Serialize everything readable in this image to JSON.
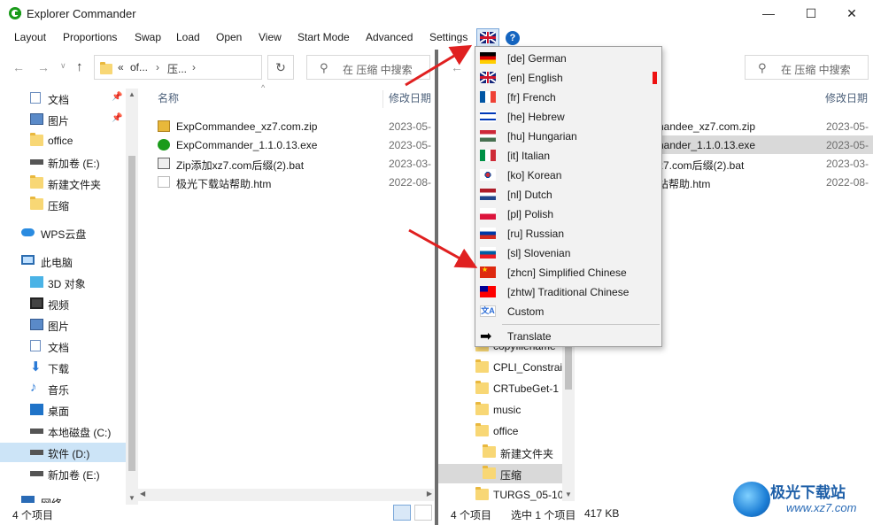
{
  "window": {
    "title": "Explorer Commander",
    "minimize": "—",
    "maximize": "☐",
    "close": "✕"
  },
  "menu": {
    "items": [
      "Layout",
      "Proportions",
      "Swap",
      "Load",
      "Open",
      "View",
      "Start Mode",
      "Advanced",
      "Settings"
    ],
    "help": "?"
  },
  "left_pane": {
    "path": [
      "«",
      "of...",
      "›",
      "压...",
      "›"
    ],
    "search_placeholder": "在 压缩 中搜索",
    "tree": [
      {
        "label": "文档",
        "icon": "document-icon",
        "pinned": true
      },
      {
        "label": "图片",
        "icon": "pictures-icon",
        "pinned": true
      },
      {
        "label": "office",
        "icon": "folder-icon"
      },
      {
        "label": "新加卷 (E:)",
        "icon": "drive-icon"
      },
      {
        "label": "新建文件夹",
        "icon": "folder-icon"
      },
      {
        "label": "压缩",
        "icon": "folder-icon"
      },
      {
        "label": "WPS云盘",
        "icon": "cloud-icon"
      },
      {
        "label": "此电脑",
        "icon": "computer-icon"
      },
      {
        "label": "3D 对象",
        "icon": "3d-objects-icon"
      },
      {
        "label": "视频",
        "icon": "video-icon"
      },
      {
        "label": "图片",
        "icon": "pictures-icon"
      },
      {
        "label": "文档",
        "icon": "document-icon"
      },
      {
        "label": "下载",
        "icon": "download-icon"
      },
      {
        "label": "音乐",
        "icon": "music-icon"
      },
      {
        "label": "桌面",
        "icon": "desktop-icon"
      },
      {
        "label": "本地磁盘 (C:)",
        "icon": "drive-icon"
      },
      {
        "label": "软件 (D:)",
        "icon": "drive-icon",
        "selected": true
      },
      {
        "label": "新加卷 (E:)",
        "icon": "drive-icon"
      },
      {
        "label": "网络",
        "icon": "network-icon"
      }
    ],
    "columns": {
      "name": "名称",
      "modified": "修改日期"
    },
    "files": [
      {
        "name": "ExpCommandee_xz7.com.zip",
        "date": "2023-05-",
        "icon": "zip-icon"
      },
      {
        "name": "ExpCommander_1.1.0.13.exe",
        "date": "2023-05-",
        "icon": "app-icon"
      },
      {
        "name": "Zip添加xz7.com后缀(2).bat",
        "date": "2023-03-",
        "icon": "batch-icon"
      },
      {
        "name": "极光下载站帮助.htm",
        "date": "2022-08-",
        "icon": "html-icon"
      }
    ],
    "status": "4 个项目"
  },
  "right_pane": {
    "search_placeholder": "在 压缩 中搜索",
    "tree": [
      {
        "label": "copyfilename",
        "icon": "folder-icon"
      },
      {
        "label": "CPLI_Constrai",
        "icon": "folder-icon"
      },
      {
        "label": "CRTubeGet-1",
        "icon": "folder-icon"
      },
      {
        "label": "music",
        "icon": "folder-icon"
      },
      {
        "label": "office",
        "icon": "folder-icon"
      },
      {
        "label": "新建文件夹",
        "icon": "folder-icon"
      },
      {
        "label": "压缩",
        "icon": "folder-icon",
        "selected": true
      },
      {
        "label": "TURGS_05-10",
        "icon": "folder-icon"
      }
    ],
    "columns": {
      "modified": "修改日期"
    },
    "files": [
      {
        "name": "nandee_xz7.com.zip",
        "date": "2023-05-"
      },
      {
        "name": "nander_1.1.0.13.exe",
        "date": "2023-05-",
        "selected": true
      },
      {
        "name": "z7.com后缀(2).bat",
        "date": "2023-03-"
      },
      {
        "name": "站帮助.htm",
        "date": "2022-08-"
      }
    ],
    "status": "4 个项目",
    "selection": "选中 1 个项目",
    "size": "417 KB"
  },
  "language_menu": {
    "items": [
      {
        "label": "[de] German",
        "flag": "germany-flag-icon"
      },
      {
        "label": "[en] English",
        "flag": "uk-flag-icon",
        "checked": true
      },
      {
        "label": "[fr] French",
        "flag": "france-flag-icon"
      },
      {
        "label": "[he] Hebrew",
        "flag": "israel-flag-icon"
      },
      {
        "label": "[hu] Hungarian",
        "flag": "hungary-flag-icon"
      },
      {
        "label": "[it] Italian",
        "flag": "italy-flag-icon"
      },
      {
        "label": "[ko] Korean",
        "flag": "korea-flag-icon"
      },
      {
        "label": "[nl] Dutch",
        "flag": "netherlands-flag-icon"
      },
      {
        "label": "[pl] Polish",
        "flag": "poland-flag-icon"
      },
      {
        "label": "[ru] Russian",
        "flag": "russia-flag-icon"
      },
      {
        "label": "[sl] Slovenian",
        "flag": "slovenia-flag-icon"
      },
      {
        "label": "[zhcn] Simplified Chinese",
        "flag": "china-flag-icon"
      },
      {
        "label": "[zhtw] Traditional Chinese",
        "flag": "taiwan-flag-icon"
      },
      {
        "label": "Custom",
        "flag": "translate-icon"
      }
    ],
    "translate": "Translate"
  },
  "watermark": {
    "text": "极光下载站",
    "url": "www.xz7.com"
  },
  "colors": {
    "selection": "#cce4f7",
    "row_selected": "#d9d9d9",
    "accent": "#1565c0",
    "arrow": "#e02020"
  }
}
